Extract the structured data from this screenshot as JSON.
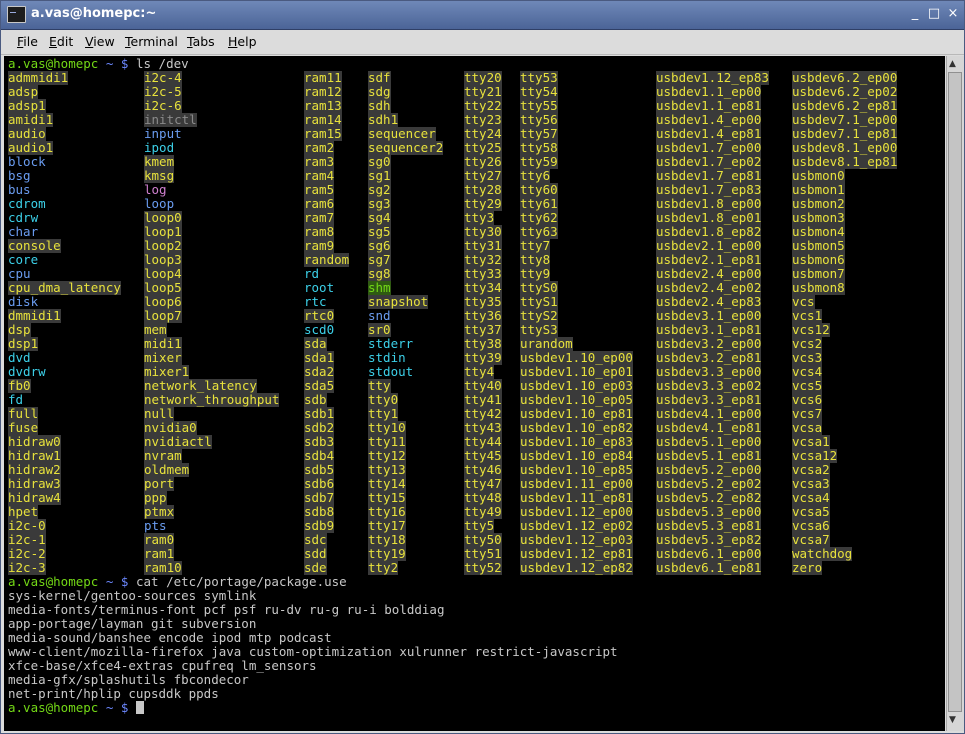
{
  "window": {
    "title": "a.vas@homepc:~",
    "buttons": {
      "minimize": "_",
      "maximize": "□",
      "close": "×"
    }
  },
  "menu": [
    {
      "label": "File",
      "key": "F",
      "rest": "ile"
    },
    {
      "label": "Edit",
      "key": "E",
      "rest": "dit"
    },
    {
      "label": "View",
      "key": "V",
      "rest": "iew"
    },
    {
      "label": "Terminal",
      "key": "T",
      "rest": "erminal"
    },
    {
      "label": "Tabs",
      "key": "T",
      "rest": "abs"
    },
    {
      "label": "Help",
      "key": "H",
      "rest": "elp"
    }
  ],
  "prompt": {
    "user": "a.vas@homepc",
    "dir": "~",
    "symbol": "$"
  },
  "commands": [
    "ls /dev",
    "cat /etc/portage/package.use",
    ""
  ],
  "ls_columns": [
    [
      [
        "admmidi1",
        "c"
      ],
      [
        "adsp",
        "c"
      ],
      [
        "adsp1",
        "c"
      ],
      [
        "amidi1",
        "c"
      ],
      [
        "audio",
        "c"
      ],
      [
        "audio1",
        "c"
      ],
      [
        "block",
        "d"
      ],
      [
        "bsg",
        "d"
      ],
      [
        "bus",
        "d"
      ],
      [
        "cdrom",
        "l"
      ],
      [
        "cdrw",
        "l"
      ],
      [
        "char",
        "d"
      ],
      [
        "console",
        "c"
      ],
      [
        "core",
        "l"
      ],
      [
        "cpu",
        "d"
      ],
      [
        "cpu_dma_latency",
        "c"
      ],
      [
        "disk",
        "d"
      ],
      [
        "dmmidi1",
        "c"
      ],
      [
        "dsp",
        "c"
      ],
      [
        "dsp1",
        "c"
      ],
      [
        "dvd",
        "l"
      ],
      [
        "dvdrw",
        "l"
      ],
      [
        "fb0",
        "c"
      ],
      [
        "fd",
        "l"
      ],
      [
        "full",
        "c"
      ],
      [
        "fuse",
        "c"
      ],
      [
        "hidraw0",
        "c"
      ],
      [
        "hidraw1",
        "c"
      ],
      [
        "hidraw2",
        "c"
      ],
      [
        "hidraw3",
        "c"
      ],
      [
        "hidraw4",
        "c"
      ],
      [
        "hpet",
        "c"
      ],
      [
        "i2c-0",
        "c"
      ],
      [
        "i2c-1",
        "c"
      ],
      [
        "i2c-2",
        "c"
      ],
      [
        "i2c-3",
        "c"
      ]
    ],
    [
      [
        "i2c-4",
        "c"
      ],
      [
        "i2c-5",
        "c"
      ],
      [
        "i2c-6",
        "c"
      ],
      [
        "initctl",
        "g"
      ],
      [
        "input",
        "d"
      ],
      [
        "ipod",
        "l"
      ],
      [
        "kmem",
        "c"
      ],
      [
        "kmsg",
        "c"
      ],
      [
        "log",
        "s"
      ],
      [
        "loop",
        "d"
      ],
      [
        "loop0",
        "c"
      ],
      [
        "loop1",
        "c"
      ],
      [
        "loop2",
        "c"
      ],
      [
        "loop3",
        "c"
      ],
      [
        "loop4",
        "c"
      ],
      [
        "loop5",
        "c"
      ],
      [
        "loop6",
        "c"
      ],
      [
        "loop7",
        "c"
      ],
      [
        "mem",
        "c"
      ],
      [
        "midi1",
        "c"
      ],
      [
        "mixer",
        "c"
      ],
      [
        "mixer1",
        "c"
      ],
      [
        "network_latency",
        "c"
      ],
      [
        "network_throughput",
        "c"
      ],
      [
        "null",
        "c"
      ],
      [
        "nvidia0",
        "c"
      ],
      [
        "nvidiactl",
        "c"
      ],
      [
        "nvram",
        "c"
      ],
      [
        "oldmem",
        "c"
      ],
      [
        "port",
        "c"
      ],
      [
        "ppp",
        "c"
      ],
      [
        "ptmx",
        "c"
      ],
      [
        "pts",
        "d"
      ],
      [
        "ram0",
        "c"
      ],
      [
        "ram1",
        "c"
      ],
      [
        "ram10",
        "c"
      ]
    ],
    [
      [
        "ram11",
        "c"
      ],
      [
        "ram12",
        "c"
      ],
      [
        "ram13",
        "c"
      ],
      [
        "ram14",
        "c"
      ],
      [
        "ram15",
        "c"
      ],
      [
        "ram2",
        "c"
      ],
      [
        "ram3",
        "c"
      ],
      [
        "ram4",
        "c"
      ],
      [
        "ram5",
        "c"
      ],
      [
        "ram6",
        "c"
      ],
      [
        "ram7",
        "c"
      ],
      [
        "ram8",
        "c"
      ],
      [
        "ram9",
        "c"
      ],
      [
        "random",
        "c"
      ],
      [
        "rd",
        "l"
      ],
      [
        "root",
        "l"
      ],
      [
        "rtc",
        "l"
      ],
      [
        "rtc0",
        "c"
      ],
      [
        "scd0",
        "l"
      ],
      [
        "sda",
        "c"
      ],
      [
        "sda1",
        "c"
      ],
      [
        "sda2",
        "c"
      ],
      [
        "sda5",
        "c"
      ],
      [
        "sdb",
        "c"
      ],
      [
        "sdb1",
        "c"
      ],
      [
        "sdb2",
        "c"
      ],
      [
        "sdb3",
        "c"
      ],
      [
        "sdb4",
        "c"
      ],
      [
        "sdb5",
        "c"
      ],
      [
        "sdb6",
        "c"
      ],
      [
        "sdb7",
        "c"
      ],
      [
        "sdb8",
        "c"
      ],
      [
        "sdb9",
        "c"
      ],
      [
        "sdc",
        "c"
      ],
      [
        "sdd",
        "c"
      ],
      [
        "sde",
        "c"
      ]
    ],
    [
      [
        "sdf",
        "c"
      ],
      [
        "sdg",
        "c"
      ],
      [
        "sdh",
        "c"
      ],
      [
        "sdh1",
        "c"
      ],
      [
        "sequencer",
        "c"
      ],
      [
        "sequencer2",
        "c"
      ],
      [
        "sg0",
        "c"
      ],
      [
        "sg1",
        "c"
      ],
      [
        "sg2",
        "c"
      ],
      [
        "sg3",
        "c"
      ],
      [
        "sg4",
        "c"
      ],
      [
        "sg5",
        "c"
      ],
      [
        "sg6",
        "c"
      ],
      [
        "sg7",
        "c"
      ],
      [
        "sg8",
        "c"
      ],
      [
        "shm",
        "w"
      ],
      [
        "snapshot",
        "c"
      ],
      [
        "snd",
        "d"
      ],
      [
        "sr0",
        "c"
      ],
      [
        "stderr",
        "l"
      ],
      [
        "stdin",
        "l"
      ],
      [
        "stdout",
        "l"
      ],
      [
        "tty",
        "c"
      ],
      [
        "tty0",
        "c"
      ],
      [
        "tty1",
        "c"
      ],
      [
        "tty10",
        "c"
      ],
      [
        "tty11",
        "c"
      ],
      [
        "tty12",
        "c"
      ],
      [
        "tty13",
        "c"
      ],
      [
        "tty14",
        "c"
      ],
      [
        "tty15",
        "c"
      ],
      [
        "tty16",
        "c"
      ],
      [
        "tty17",
        "c"
      ],
      [
        "tty18",
        "c"
      ],
      [
        "tty19",
        "c"
      ],
      [
        "tty2",
        "c"
      ]
    ],
    [
      [
        "tty20",
        "c"
      ],
      [
        "tty21",
        "c"
      ],
      [
        "tty22",
        "c"
      ],
      [
        "tty23",
        "c"
      ],
      [
        "tty24",
        "c"
      ],
      [
        "tty25",
        "c"
      ],
      [
        "tty26",
        "c"
      ],
      [
        "tty27",
        "c"
      ],
      [
        "tty28",
        "c"
      ],
      [
        "tty29",
        "c"
      ],
      [
        "tty3",
        "c"
      ],
      [
        "tty30",
        "c"
      ],
      [
        "tty31",
        "c"
      ],
      [
        "tty32",
        "c"
      ],
      [
        "tty33",
        "c"
      ],
      [
        "tty34",
        "c"
      ],
      [
        "tty35",
        "c"
      ],
      [
        "tty36",
        "c"
      ],
      [
        "tty37",
        "c"
      ],
      [
        "tty38",
        "c"
      ],
      [
        "tty39",
        "c"
      ],
      [
        "tty4",
        "c"
      ],
      [
        "tty40",
        "c"
      ],
      [
        "tty41",
        "c"
      ],
      [
        "tty42",
        "c"
      ],
      [
        "tty43",
        "c"
      ],
      [
        "tty44",
        "c"
      ],
      [
        "tty45",
        "c"
      ],
      [
        "tty46",
        "c"
      ],
      [
        "tty47",
        "c"
      ],
      [
        "tty48",
        "c"
      ],
      [
        "tty49",
        "c"
      ],
      [
        "tty5",
        "c"
      ],
      [
        "tty50",
        "c"
      ],
      [
        "tty51",
        "c"
      ],
      [
        "tty52",
        "c"
      ]
    ],
    [
      [
        "tty53",
        "c"
      ],
      [
        "tty54",
        "c"
      ],
      [
        "tty55",
        "c"
      ],
      [
        "tty56",
        "c"
      ],
      [
        "tty57",
        "c"
      ],
      [
        "tty58",
        "c"
      ],
      [
        "tty59",
        "c"
      ],
      [
        "tty6",
        "c"
      ],
      [
        "tty60",
        "c"
      ],
      [
        "tty61",
        "c"
      ],
      [
        "tty62",
        "c"
      ],
      [
        "tty63",
        "c"
      ],
      [
        "tty7",
        "c"
      ],
      [
        "tty8",
        "c"
      ],
      [
        "tty9",
        "c"
      ],
      [
        "ttyS0",
        "c"
      ],
      [
        "ttyS1",
        "c"
      ],
      [
        "ttyS2",
        "c"
      ],
      [
        "ttyS3",
        "c"
      ],
      [
        "urandom",
        "c"
      ],
      [
        "usbdev1.10_ep00",
        "c"
      ],
      [
        "usbdev1.10_ep01",
        "c"
      ],
      [
        "usbdev1.10_ep03",
        "c"
      ],
      [
        "usbdev1.10_ep05",
        "c"
      ],
      [
        "usbdev1.10_ep81",
        "c"
      ],
      [
        "usbdev1.10_ep82",
        "c"
      ],
      [
        "usbdev1.10_ep83",
        "c"
      ],
      [
        "usbdev1.10_ep84",
        "c"
      ],
      [
        "usbdev1.10_ep85",
        "c"
      ],
      [
        "usbdev1.11_ep00",
        "c"
      ],
      [
        "usbdev1.11_ep81",
        "c"
      ],
      [
        "usbdev1.12_ep00",
        "c"
      ],
      [
        "usbdev1.12_ep02",
        "c"
      ],
      [
        "usbdev1.12_ep03",
        "c"
      ],
      [
        "usbdev1.12_ep81",
        "c"
      ],
      [
        "usbdev1.12_ep82",
        "c"
      ]
    ],
    [
      [
        "usbdev1.12_ep83",
        "c"
      ],
      [
        "usbdev1.1_ep00",
        "c"
      ],
      [
        "usbdev1.1_ep81",
        "c"
      ],
      [
        "usbdev1.4_ep00",
        "c"
      ],
      [
        "usbdev1.4_ep81",
        "c"
      ],
      [
        "usbdev1.7_ep00",
        "c"
      ],
      [
        "usbdev1.7_ep02",
        "c"
      ],
      [
        "usbdev1.7_ep81",
        "c"
      ],
      [
        "usbdev1.7_ep83",
        "c"
      ],
      [
        "usbdev1.8_ep00",
        "c"
      ],
      [
        "usbdev1.8_ep01",
        "c"
      ],
      [
        "usbdev1.8_ep82",
        "c"
      ],
      [
        "usbdev2.1_ep00",
        "c"
      ],
      [
        "usbdev2.1_ep81",
        "c"
      ],
      [
        "usbdev2.4_ep00",
        "c"
      ],
      [
        "usbdev2.4_ep02",
        "c"
      ],
      [
        "usbdev2.4_ep83",
        "c"
      ],
      [
        "usbdev3.1_ep00",
        "c"
      ],
      [
        "usbdev3.1_ep81",
        "c"
      ],
      [
        "usbdev3.2_ep00",
        "c"
      ],
      [
        "usbdev3.2_ep81",
        "c"
      ],
      [
        "usbdev3.3_ep00",
        "c"
      ],
      [
        "usbdev3.3_ep02",
        "c"
      ],
      [
        "usbdev3.3_ep81",
        "c"
      ],
      [
        "usbdev4.1_ep00",
        "c"
      ],
      [
        "usbdev4.1_ep81",
        "c"
      ],
      [
        "usbdev5.1_ep00",
        "c"
      ],
      [
        "usbdev5.1_ep81",
        "c"
      ],
      [
        "usbdev5.2_ep00",
        "c"
      ],
      [
        "usbdev5.2_ep02",
        "c"
      ],
      [
        "usbdev5.2_ep82",
        "c"
      ],
      [
        "usbdev5.3_ep00",
        "c"
      ],
      [
        "usbdev5.3_ep81",
        "c"
      ],
      [
        "usbdev5.3_ep82",
        "c"
      ],
      [
        "usbdev6.1_ep00",
        "c"
      ],
      [
        "usbdev6.1_ep81",
        "c"
      ]
    ],
    [
      [
        "usbdev6.2_ep00",
        "c"
      ],
      [
        "usbdev6.2_ep02",
        "c"
      ],
      [
        "usbdev6.2_ep81",
        "c"
      ],
      [
        "usbdev7.1_ep00",
        "c"
      ],
      [
        "usbdev7.1_ep81",
        "c"
      ],
      [
        "usbdev8.1_ep00",
        "c"
      ],
      [
        "usbdev8.1_ep81",
        "c"
      ],
      [
        "usbmon0",
        "c"
      ],
      [
        "usbmon1",
        "c"
      ],
      [
        "usbmon2",
        "c"
      ],
      [
        "usbmon3",
        "c"
      ],
      [
        "usbmon4",
        "c"
      ],
      [
        "usbmon5",
        "c"
      ],
      [
        "usbmon6",
        "c"
      ],
      [
        "usbmon7",
        "c"
      ],
      [
        "usbmon8",
        "c"
      ],
      [
        "vcs",
        "c"
      ],
      [
        "vcs1",
        "c"
      ],
      [
        "vcs12",
        "c"
      ],
      [
        "vcs2",
        "c"
      ],
      [
        "vcs3",
        "c"
      ],
      [
        "vcs4",
        "c"
      ],
      [
        "vcs5",
        "c"
      ],
      [
        "vcs6",
        "c"
      ],
      [
        "vcs7",
        "c"
      ],
      [
        "vcsa",
        "c"
      ],
      [
        "vcsa1",
        "c"
      ],
      [
        "vcsa12",
        "c"
      ],
      [
        "vcsa2",
        "c"
      ],
      [
        "vcsa3",
        "c"
      ],
      [
        "vcsa4",
        "c"
      ],
      [
        "vcsa5",
        "c"
      ],
      [
        "vcsa6",
        "c"
      ],
      [
        "vcsa7",
        "c"
      ],
      [
        "watchdog",
        "c"
      ],
      [
        "zero",
        "c"
      ]
    ]
  ],
  "cat_output": [
    "sys-kernel/gentoo-sources symlink",
    "media-fonts/terminus-font pcf psf ru-dv ru-g ru-i bolddiag",
    "app-portage/layman git subversion",
    "media-sound/banshee encode ipod mtp podcast",
    "www-client/mozilla-firefox java custom-optimization xulrunner restrict-javascript",
    "xfce-base/xfce4-extras cpufreq lm_sensors",
    "media-gfx/splashutils fbcondecor",
    "net-print/hplip cupsddk ppds"
  ],
  "colors": {
    "user_host": "#73d816",
    "path": "#6c88ff",
    "device": "#e8e23c",
    "directory": "#6a9cf0",
    "symlink": "#3cd0e8",
    "text": "#c8c8c8"
  }
}
